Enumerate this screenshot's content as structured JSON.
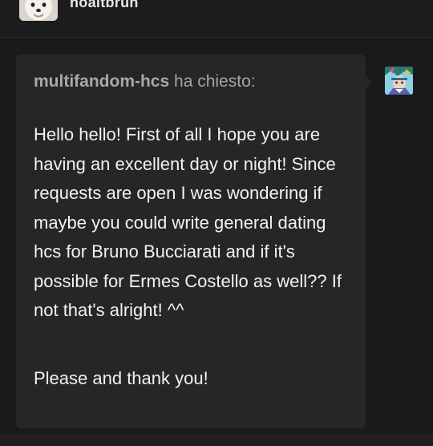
{
  "post": {
    "username": "noaltbruh"
  },
  "ask": {
    "asker": "multifandom-hcs",
    "verb": "ha chiesto:",
    "question": "Hello hello! First of all I hope you are having an excellent day or night! Since requests are open I was wondering if maybe you could write general dating hcs for Bruno Bucciarati and if it's possible for Ermes Costello as well?? If not that's alright!  ^^",
    "signoff": "Please and thank you!"
  },
  "icons": {
    "poster_avatar": "dog-avatar-icon",
    "asker_avatar": "anime-character-avatar-icon"
  },
  "colors": {
    "background": "#1a1a1a",
    "card": "#262626",
    "text": "#f2f2f2",
    "muted": "#a5a5a5"
  }
}
